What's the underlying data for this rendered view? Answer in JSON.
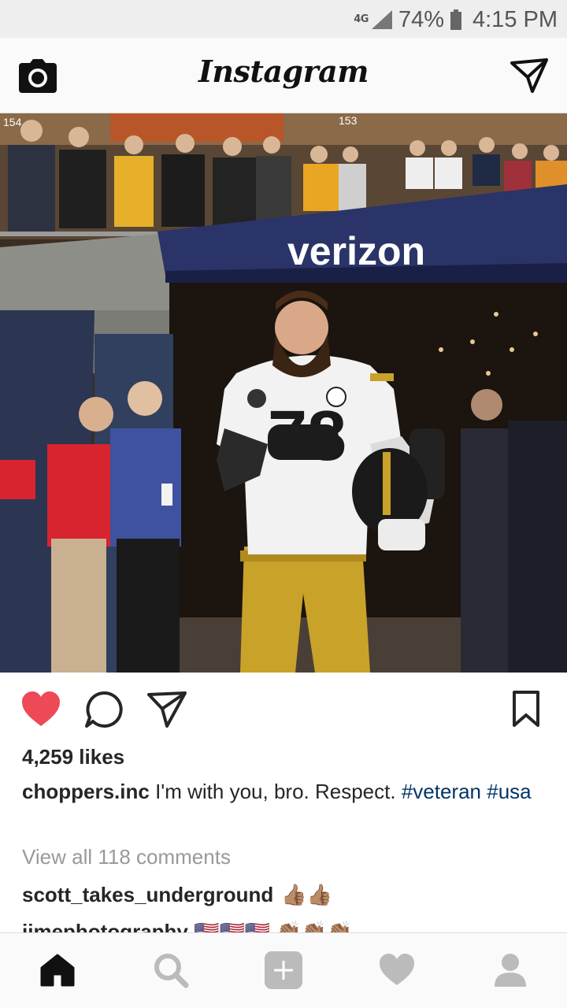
{
  "status_bar": {
    "network_type": "4G",
    "battery_percent": "74%",
    "time": "4:15 PM"
  },
  "header": {
    "logo_text": "Instagram",
    "left_icon": "camera-icon",
    "right_icon": "direct-message-icon"
  },
  "post": {
    "photo_signage": "verizon",
    "jersey_number": "78",
    "section_numbers": [
      "154",
      "153"
    ],
    "liked": true,
    "likes_text": "4,259 likes",
    "caption": {
      "username": "choppers.inc",
      "text": "I'm with you, bro. Respect.",
      "hashtags": [
        "#veteran",
        "#usa"
      ]
    },
    "view_all_comments": "View all 118 comments",
    "comments": [
      {
        "username": "scott_takes_underground",
        "emoji": "👍🏽👍🏽"
      },
      {
        "username": "jjmephotography",
        "emoji": "🇺🇸🇺🇸🇺🇸 👏🏽👏🏽👏🏽"
      }
    ]
  },
  "bottom_nav": {
    "items": [
      "home-icon",
      "search-icon",
      "add-post-icon",
      "activity-heart-icon",
      "profile-icon"
    ],
    "active": "home-icon"
  },
  "colors": {
    "like_red": "#ed4956",
    "hashtag_blue": "#003569",
    "muted_gray": "#999999",
    "verizon_navy": "#23305e",
    "jersey_gold": "#c9a22a"
  }
}
